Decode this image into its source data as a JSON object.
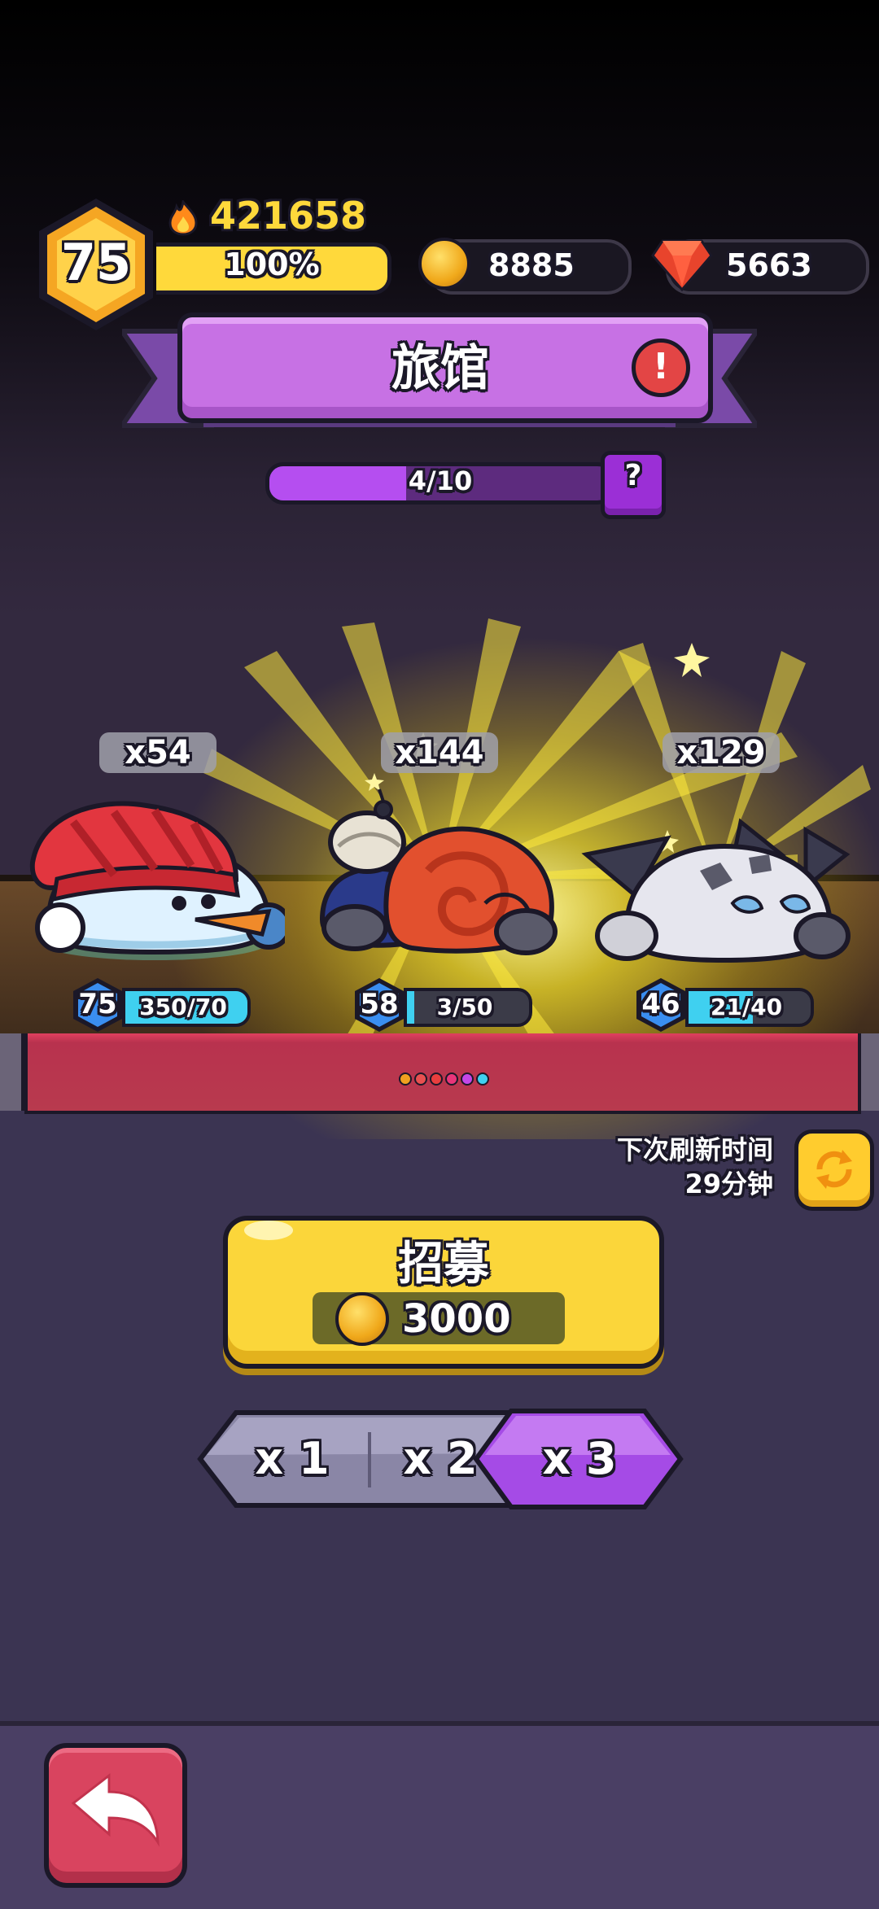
{
  "header": {
    "level": "75",
    "xp_percent_text": "100%",
    "xp_fraction": 1.0,
    "power": "421658",
    "coins": "8885",
    "gems": "5663"
  },
  "title": {
    "text": "旅馆",
    "alert_glyph": "!"
  },
  "progress": {
    "text": "4/10",
    "fraction": 0.4,
    "help_glyph": "?"
  },
  "heroes": [
    {
      "name_icon": "snowman-hero-icon",
      "count": "x54",
      "level": "75",
      "hp_text": "350/70",
      "hp_fraction": 1.0
    },
    {
      "name_icon": "shell-bomb-hero-icon",
      "count": "x144",
      "level": "58",
      "hp_text": "3/50",
      "hp_fraction": 0.06
    },
    {
      "name_icon": "spiky-rock-hero-icon",
      "count": "x129",
      "level": "46",
      "hp_text": "21/40",
      "hp_fraction": 0.525
    }
  ],
  "page_dots": [
    "#f0a020",
    "#e85050",
    "#e83e3e",
    "#e8357a",
    "#c447e8",
    "#3fd0f0"
  ],
  "refresh": {
    "label": "下次刷新时间",
    "time": "29分钟"
  },
  "recruit": {
    "label": "招募",
    "cost": "3000"
  },
  "multipliers": [
    {
      "label": "x 1",
      "selected": false
    },
    {
      "label": "x 2",
      "selected": false
    },
    {
      "label": "x 3",
      "selected": true
    }
  ],
  "colors": {
    "accent_purple": "#c771e4",
    "recruit_yellow": "#fbd63a",
    "back_red": "#d9445f",
    "hp_cyan": "#3fd0f0"
  }
}
